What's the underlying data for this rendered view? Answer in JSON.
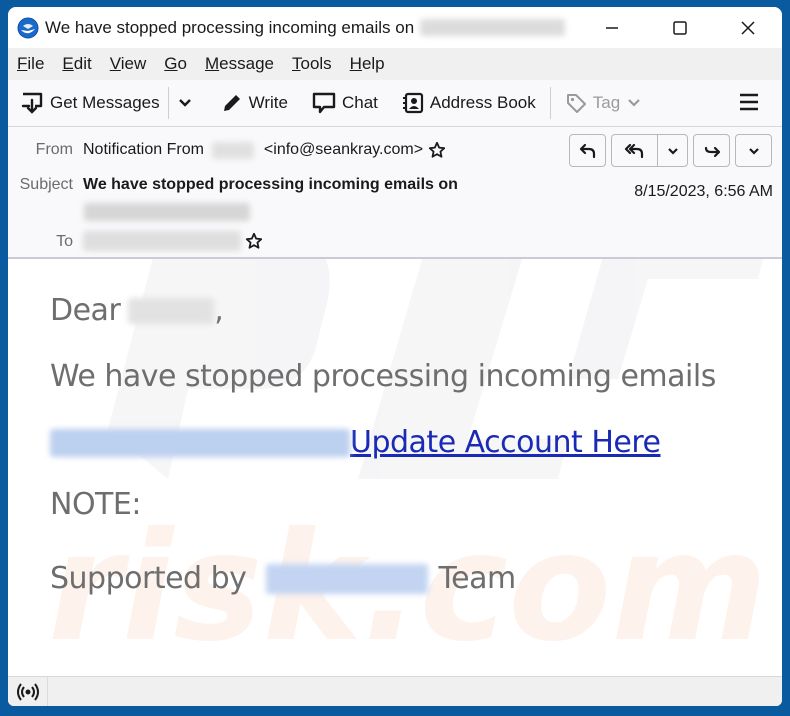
{
  "window": {
    "title": "We have stopped processing incoming emails on",
    "title_redacted": true,
    "controls": {
      "minimize": "minimize",
      "maximize": "maximize",
      "close": "close"
    }
  },
  "menubar": {
    "items": [
      {
        "accel": "F",
        "rest": "ile"
      },
      {
        "accel": "E",
        "rest": "dit"
      },
      {
        "accel": "V",
        "rest": "iew"
      },
      {
        "accel": "G",
        "rest": "o"
      },
      {
        "accel": "M",
        "rest": "essage"
      },
      {
        "accel": "T",
        "rest": "ools"
      },
      {
        "accel": "H",
        "rest": "elp"
      }
    ]
  },
  "toolbar": {
    "get_messages": "Get Messages",
    "write": "Write",
    "chat": "Chat",
    "address_book": "Address Book",
    "tag": "Tag"
  },
  "header": {
    "from_label": "From",
    "from_name": "Notification From",
    "from_email": "<info@seankray.com>",
    "subject_label": "Subject",
    "subject": "We have stopped processing incoming emails on",
    "to_label": "To",
    "date": "8/15/2023, 6:56 AM"
  },
  "body": {
    "greeting": "Dear",
    "greeting_suffix": ",",
    "line1": "We have stopped processing incoming emails",
    "link_text": " Update Account Here",
    "note": "NOTE:",
    "supported_prefix": "Supported by",
    "supported_suffix": "Team"
  },
  "colors": {
    "link": "#1a2ab4",
    "body_text": "#6e6e6e",
    "frame": "#0a5aa0"
  }
}
